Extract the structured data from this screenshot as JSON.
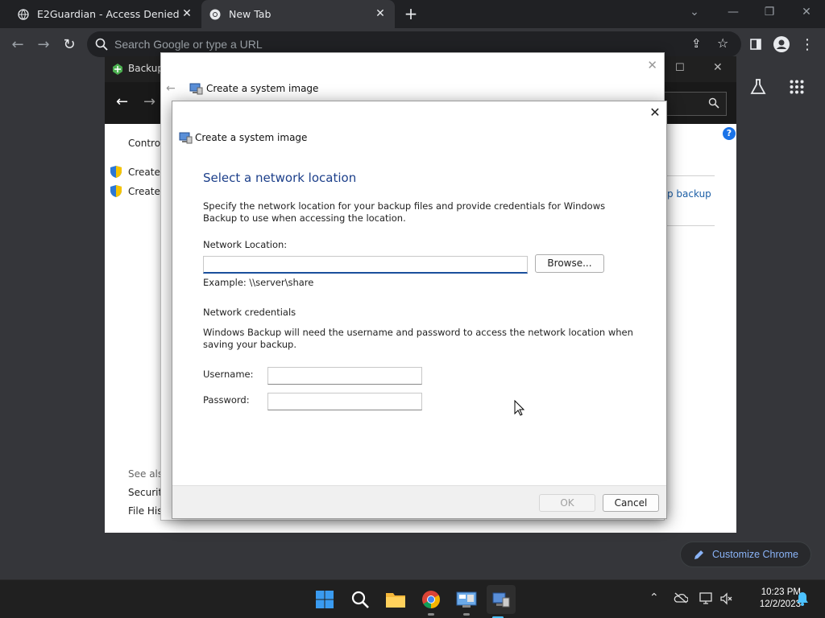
{
  "browser": {
    "tabs": [
      {
        "title": "E2Guardian - Access Denied"
      },
      {
        "title": "New Tab"
      }
    ],
    "omnibox_placeholder": "Search Google or type a URL",
    "customize_label": "Customize Chrome"
  },
  "control_panel": {
    "title": "Backup",
    "left_links": [
      "Control",
      "Create a",
      "Create a"
    ],
    "see_also": "See also",
    "bottom_links": [
      "Security",
      "File Hist"
    ],
    "right_link": "p backup"
  },
  "wizard_back": {
    "title": "Create a system image"
  },
  "dialog": {
    "caption": "Create a system image",
    "heading": "Select a network location",
    "description": "Specify the network location for your backup files and provide credentials for Windows Backup to use when accessing the location.",
    "network_location_label": "Network Location:",
    "network_location_value": "",
    "browse_label": "Browse...",
    "example": "Example: \\\\server\\share",
    "credentials_heading": "Network credentials",
    "credentials_description": "Windows Backup will need the username and password to access the network location when saving your backup.",
    "username_label": "Username:",
    "username_value": "",
    "password_label": "Password:",
    "password_value": "",
    "ok_label": "OK",
    "cancel_label": "Cancel"
  },
  "taskbar": {
    "time": "10:23 PM",
    "date": "12/2/2023"
  },
  "colors": {
    "accent": "#1c3f8a",
    "chrome_link": "#8ab4f8"
  }
}
